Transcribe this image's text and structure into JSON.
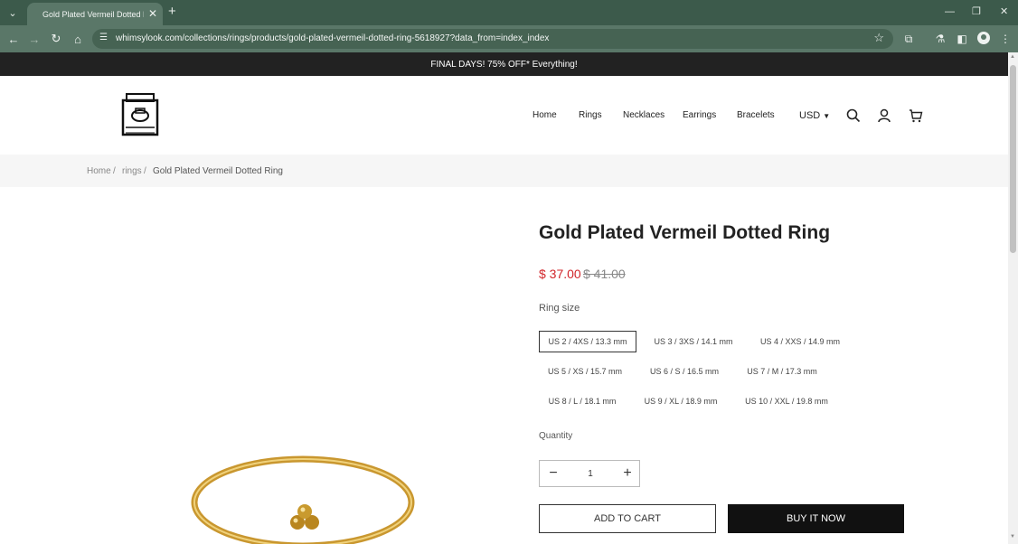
{
  "browser": {
    "tab_title": "Gold Plated Vermeil Dotted Ring",
    "tab_close": "✕",
    "new_tab": "+",
    "url": "whimsylook.com/collections/rings/products/gold-plated-vermeil-dotted-ring-5618927?data_from=index_index",
    "icons": [
      "tab-search-icon",
      "back-icon",
      "forward-icon",
      "reload-icon",
      "home-icon",
      "site-info-icon",
      "bookmark-star-icon",
      "extensions-icon",
      "labs-icon",
      "side-panel-icon",
      "profile-icon",
      "menu-icon",
      "minimize-icon",
      "maximize-icon",
      "close-icon"
    ],
    "theme_color": "#5a7768"
  },
  "announcement": "FINAL DAYS! 75% OFF* Everything!",
  "header": {
    "nav": [
      "Home",
      "Rings",
      "Necklaces",
      "Earrings",
      "Bracelets"
    ],
    "currency": "USD",
    "icons": [
      "search-icon",
      "account-icon",
      "cart-icon"
    ]
  },
  "breadcrumb": [
    "Home",
    "rings",
    "Gold Plated Vermeil Dotted Ring"
  ],
  "breadcrumb_sep": "/",
  "product": {
    "title": "Gold Plated Vermeil Dotted Ring",
    "price": "$ 37.00",
    "compare_price": "$ 41.00",
    "price_color": "#d1262b",
    "size_label": "Ring size",
    "sizes": [
      "US 2 / 4XS / 13.3 mm",
      "US 3 / 3XS / 14.1 mm",
      "US 4 / XXS / 14.9 mm",
      "US 5 / XS / 15.7 mm",
      "US 6 / S / 16.5 mm",
      "US 7 / M / 17.3 mm",
      "US 8 / L / 18.1 mm",
      "US 9 / XL / 18.9 mm",
      "US 10 / XXL / 19.8 mm"
    ],
    "selected_size": "US 2 / 4XS / 13.3 mm",
    "quantity_label": "Quantity",
    "quantity": "1",
    "add_to_cart": "ADD TO CART",
    "buy_now": "BUY IT NOW"
  }
}
